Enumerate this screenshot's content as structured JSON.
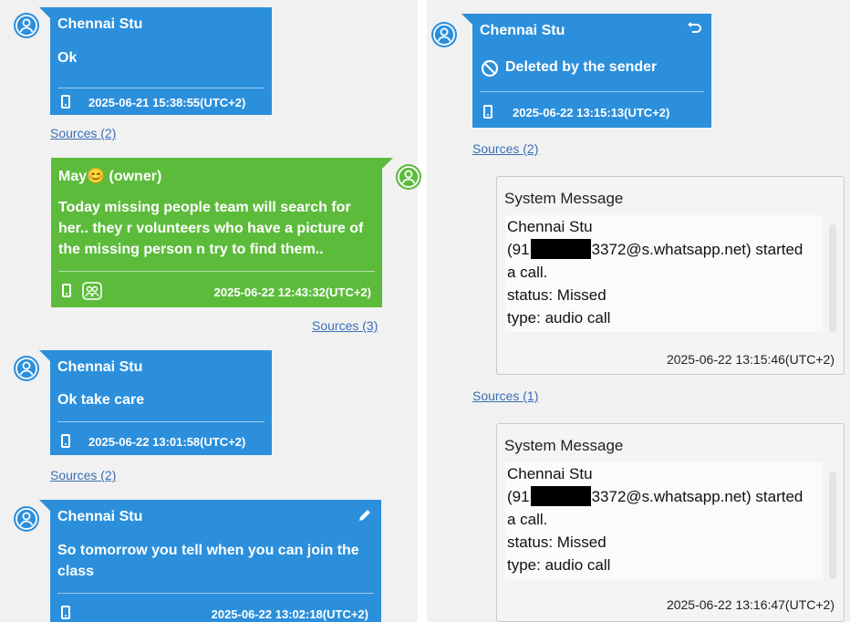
{
  "left": {
    "messages": [
      {
        "sender": "Chennai Stu",
        "text": "Ok",
        "timestamp": "2025-06-21 15:38:55(UTC+2)",
        "sources": "Sources (2)"
      },
      {
        "sender": "May😊 (owner)",
        "lines": [
          "Today missing people team will search for",
          "her.. they r volunteers who have a picture of",
          "the missing person n try to find them.."
        ],
        "timestamp": "2025-06-22 12:43:32(UTC+2)",
        "sources": "Sources (3)"
      },
      {
        "sender": "Chennai Stu",
        "text": "Ok take care",
        "timestamp": "2025-06-22 13:01:58(UTC+2)",
        "sources": "Sources (2)"
      },
      {
        "sender": "Chennai Stu",
        "lines": [
          "So tomorrow you tell when you can join the",
          "class"
        ],
        "timestamp": "2025-06-22 13:02:18(UTC+2)"
      }
    ]
  },
  "right": {
    "deleted_message": {
      "sender": "Chennai Stu",
      "text": "Deleted by the sender",
      "timestamp": "2025-06-22 13:15:13(UTC+2)",
      "sources": "Sources (2)"
    },
    "system_messages": [
      {
        "title": "System Message",
        "line1": "Chennai Stu",
        "line2_prefix": "(91",
        "line2_suffix": "3372@s.whatsapp.net) started",
        "line3": "a call.",
        "line4": "status: Missed",
        "line5": "type: audio call",
        "timestamp": "2025-06-22 13:15:46(UTC+2)",
        "sources": "Sources (1)"
      },
      {
        "title": "System Message",
        "line1": "Chennai Stu",
        "line2_prefix": "(91",
        "line2_suffix": "3372@s.whatsapp.net) started",
        "line3": "a call.",
        "line4": "status: Missed",
        "line5": "type: audio call",
        "timestamp": "2025-06-22 13:16:47(UTC+2)"
      }
    ]
  },
  "colors": {
    "incoming": "#2b8fdc",
    "outgoing": "#5dbb3c",
    "link": "#3a6fb5",
    "panel": "#f1f1f1"
  },
  "icons": [
    "user-avatar-icon",
    "phone-icon",
    "emoji-icon",
    "people-icon",
    "edit-pencil-icon",
    "undo-icon",
    "deleted-prohibited-icon"
  ]
}
